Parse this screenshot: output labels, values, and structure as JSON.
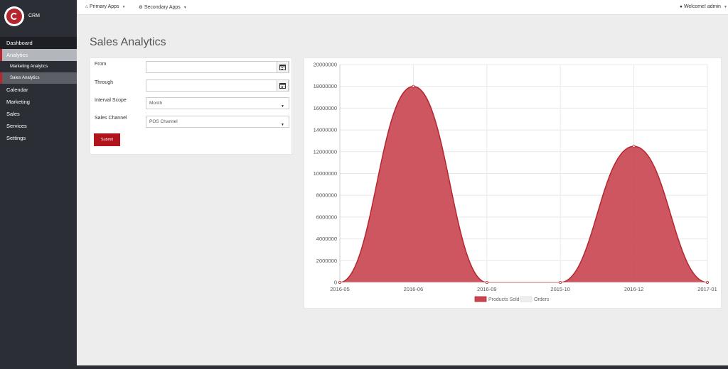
{
  "sidebar": {
    "brand": "CRM",
    "items": [
      {
        "label": "Dashboard"
      },
      {
        "label": "Analytics"
      },
      {
        "label": "Marketing Analytics"
      },
      {
        "label": "Sales Analytics"
      },
      {
        "label": "Calendar"
      },
      {
        "label": "Marketing"
      },
      {
        "label": "Sales"
      },
      {
        "label": "Services"
      },
      {
        "label": "Settings"
      }
    ]
  },
  "topbar": {
    "primary_apps": "Primary Apps",
    "secondary_apps": "Secondary Apps",
    "welcome": "Welcome! admin"
  },
  "page": {
    "title": "Sales Analytics"
  },
  "form": {
    "from_label": "From",
    "from_value": "",
    "through_label": "Through",
    "through_value": "",
    "interval_label": "Interval Scope",
    "interval_value": "Month",
    "channel_label": "Sales Channel",
    "channel_value": "POS Channel",
    "submit_label": "Submit"
  },
  "colors": {
    "accent": "#b5272f",
    "series_fill": "#c94450",
    "series_stroke": "#b5272f"
  },
  "chart_data": {
    "type": "area",
    "x": [
      "2016-05",
      "2016-06",
      "2016-09",
      "2015-10",
      "2016-12",
      "2017-01"
    ],
    "series": [
      {
        "name": "Products Sold",
        "values": [
          0,
          18000000,
          0,
          0,
          12500000,
          0
        ]
      },
      {
        "name": "Orders",
        "values": [
          0,
          0,
          0,
          0,
          0,
          0
        ]
      }
    ],
    "ylim": [
      0,
      20000000
    ],
    "yticks": [
      "0",
      "2000000",
      "4000000",
      "6000000",
      "8000000",
      "10000000",
      "12000000",
      "14000000",
      "16000000",
      "18000000",
      "20000000"
    ],
    "grid": true,
    "legend": "bottom"
  }
}
